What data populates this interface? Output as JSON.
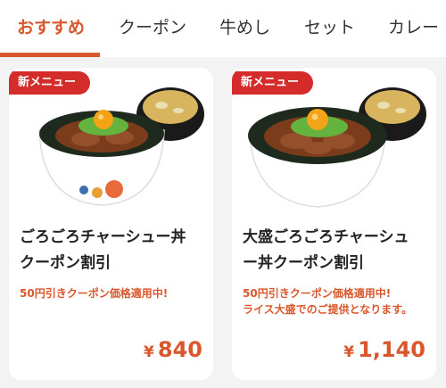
{
  "tabs": [
    {
      "label": "おすすめ",
      "active": true
    },
    {
      "label": "クーポン",
      "active": false
    },
    {
      "label": "牛めし",
      "active": false
    },
    {
      "label": "セット",
      "active": false
    },
    {
      "label": "カレー",
      "active": false
    }
  ],
  "products": [
    {
      "badge": "新メニュー",
      "title_line1": "ごろごろチャーシュー丼",
      "title_line2": "クーポン割引",
      "note_line1": "50円引きクーポン価格適用中!",
      "note_line2": "",
      "currency": "¥",
      "price": "840"
    },
    {
      "badge": "新メニュー",
      "title_line1": "大盛ごろごろチャーシュ",
      "title_line2": "ー丼クーポン割引",
      "note_line1": "50円引きクーポン価格適用中!",
      "note_line2": "ライス大盛でのご提供となります。",
      "currency": "¥",
      "price": "1,140"
    }
  ],
  "colors": {
    "accent": "#d9572c",
    "badge": "#d42b2b",
    "background": "#f3f3f3",
    "card": "#ffffff"
  }
}
